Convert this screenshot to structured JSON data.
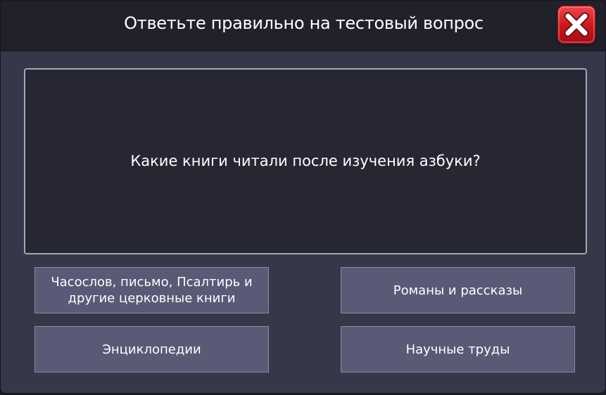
{
  "dialog": {
    "title": "Ответьте правильно на тестовый вопрос",
    "close_icon": "close-x-icon"
  },
  "question": {
    "text": "Какие книги читали после изучения азбуки?"
  },
  "answers": [
    {
      "label": "Часослов, письмо, Псалтирь и другие церковные книги"
    },
    {
      "label": "Романы и рассказы"
    },
    {
      "label": "Энциклопедии"
    },
    {
      "label": "Научные труды"
    }
  ],
  "colors": {
    "header": "#20212b",
    "panel": "#363748",
    "question_box": "#262733",
    "answer_button": "#595a76",
    "close_button": "#d9232b"
  }
}
